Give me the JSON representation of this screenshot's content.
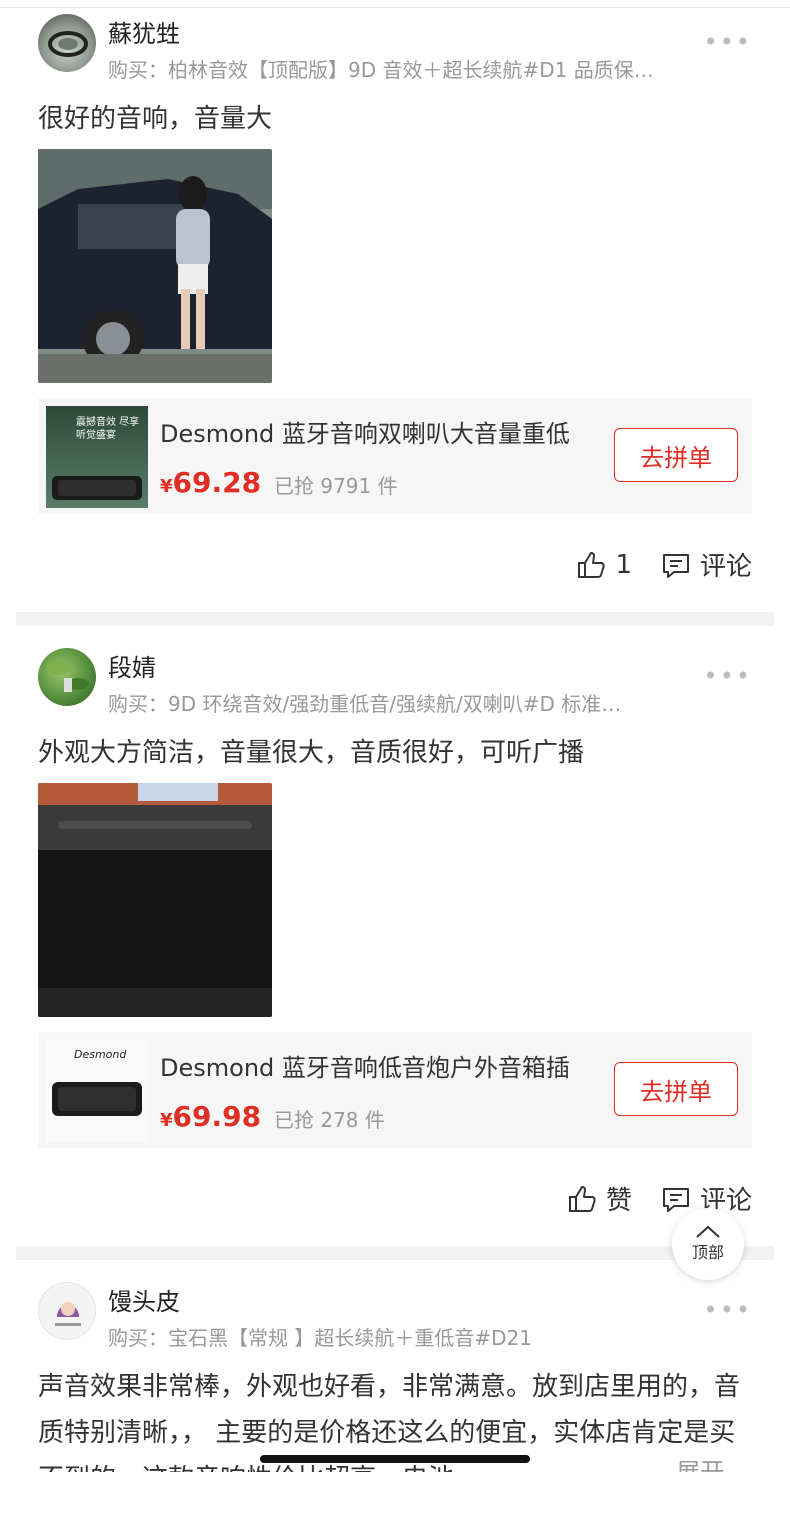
{
  "reviews": [
    {
      "username": "蘇犹甡",
      "purchase_prefix": "购买：",
      "purchase_spec": "柏林音效【顶配版】9D 音效＋超长续航#D1 品质保…",
      "more": "•••",
      "comment": "很好的音响，音量大",
      "product": {
        "title": "Desmond 蓝牙音响双喇叭大音量重低",
        "currency": "¥",
        "price": "69.28",
        "sold": "已抢 9791 件",
        "buy_label": "去拼单",
        "thumb_text": "震撼音效 尽享听觉盛宴"
      },
      "like_label": "1",
      "comment_label": "评论"
    },
    {
      "username": "段婧",
      "purchase_prefix": "购买：",
      "purchase_spec": "9D 环绕音效/强劲重低音/强续航/双喇叭#D 标准…",
      "more": "•••",
      "comment": "外观大方简洁，音量很大，音质很好，可听广播",
      "product": {
        "title": "Desmond 蓝牙音响低音炮户外音箱插",
        "currency": "¥",
        "price": "69.98",
        "sold": "已抢 278 件",
        "buy_label": "去拼单",
        "thumb_text": "Desmond"
      },
      "like_label": "赞",
      "comment_label": "评论"
    },
    {
      "username": "馒头皮",
      "purchase_prefix": "购买：",
      "purchase_spec": "宝石黑【常规 】超长续航＋重低音#D21",
      "more": "•••",
      "comment": "声音效果非常棒，外观也好看，非常满意。放到店里用的，音质特别清晰，，     主要的是价格还这么的便宜，实体店肯定是买不到的，这款音响性价比超高，电池",
      "expand_label": "展开"
    }
  ],
  "top_button": "顶部",
  "colors": {
    "accent": "#e02e24",
    "muted": "#999999"
  }
}
